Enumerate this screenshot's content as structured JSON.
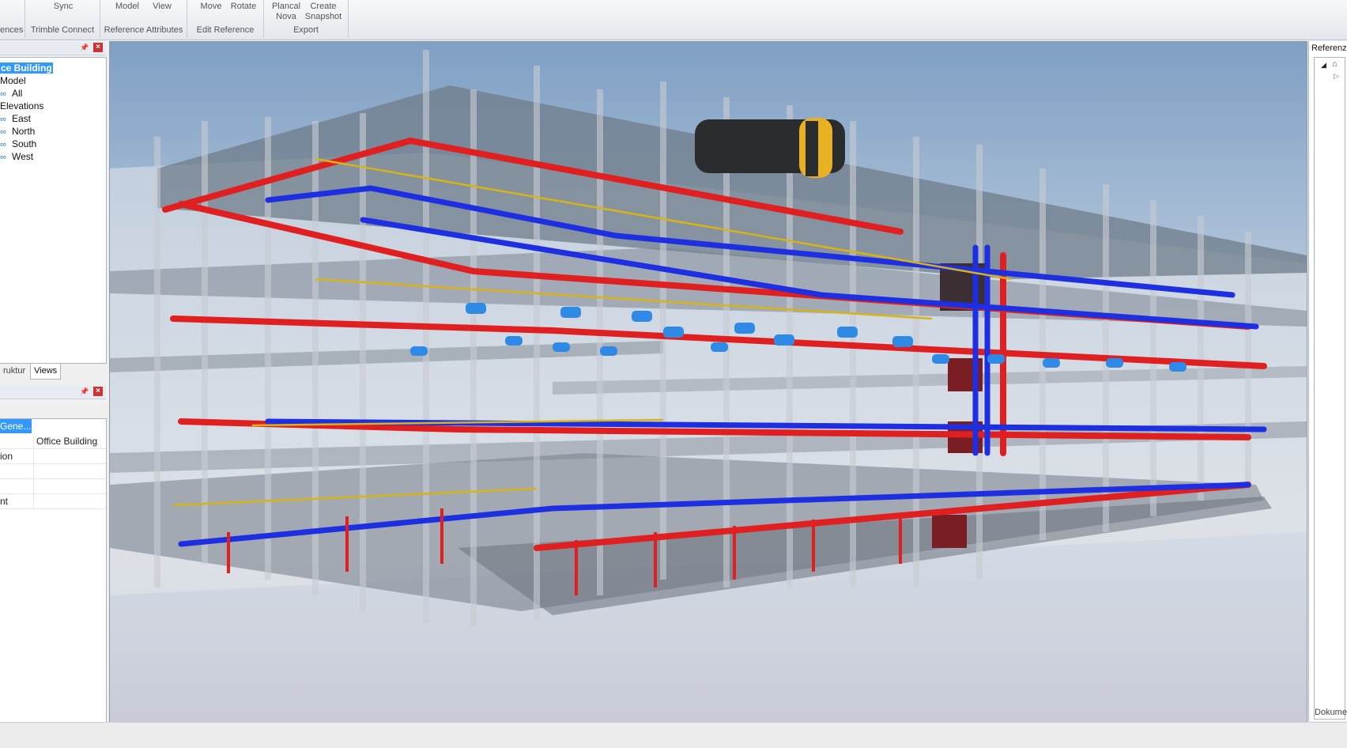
{
  "ribbon": {
    "groups": [
      {
        "label": "ences",
        "buttons": []
      },
      {
        "label": "Trimble Connect",
        "buttons": [
          "Sync"
        ]
      },
      {
        "label": "Reference Attributes",
        "buttons": [
          "Model",
          "View"
        ]
      },
      {
        "label": "Edit Reference",
        "buttons": [
          "Move",
          "Rotate"
        ]
      },
      {
        "label": "Export",
        "buttons": [
          "Plancal\nNova",
          "Create\nSnapshot"
        ]
      }
    ]
  },
  "tree": {
    "items": [
      {
        "label": "ce Building",
        "icon": "building-icon"
      },
      {
        "label": "Model",
        "icon": ""
      },
      {
        "label": "All",
        "icon": "view-icon"
      },
      {
        "label": "Elevations",
        "icon": ""
      },
      {
        "label": "East",
        "icon": "view-icon"
      },
      {
        "label": "North",
        "icon": "view-icon"
      },
      {
        "label": "South",
        "icon": "view-icon"
      },
      {
        "label": "West",
        "icon": "view-icon"
      }
    ]
  },
  "tabs": [
    "ruktur",
    "Views"
  ],
  "properties": {
    "header": "Gene...",
    "rows": [
      {
        "key": "",
        "value": "Office Building"
      },
      {
        "key": "ion",
        "value": ""
      },
      {
        "key": "",
        "value": ""
      },
      {
        "key": "",
        "value": ""
      },
      {
        "key": "nt",
        "value": ""
      }
    ]
  },
  "right_panel": {
    "title": "Referenz",
    "footer": "Dokume"
  }
}
